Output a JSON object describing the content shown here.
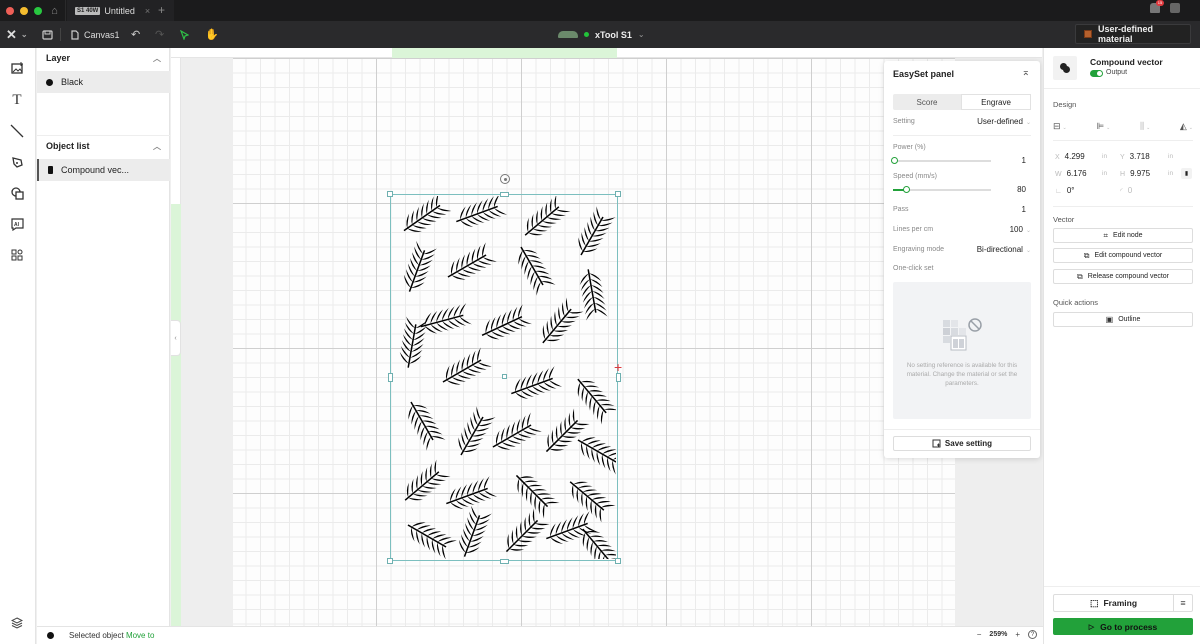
{
  "titlebar": {
    "traffic_colors": [
      "#ee5f57",
      "#f5bd2f",
      "#28c840"
    ],
    "home_icon": "home-icon",
    "tab": {
      "badge": "S1 40W",
      "title": "Untitled",
      "close": "×"
    },
    "new_tab": "+",
    "notification_count": "15"
  },
  "toolbar": {
    "logo": "✕",
    "logo_chevron": "⌄",
    "canvas_label": "Canvas1",
    "device_name": "xTool S1",
    "device_status_color": "#22c33a",
    "device_chevron": "⌄",
    "material_label": "User-defined material",
    "material_color": "#b5602d"
  },
  "left_tools": [
    {
      "name": "image-icon",
      "glyph": "🖼"
    },
    {
      "name": "text-icon",
      "glyph": "T"
    },
    {
      "name": "line-icon",
      "glyph": "╲"
    },
    {
      "name": "pen-icon",
      "glyph": "✎"
    },
    {
      "name": "shapes-icon",
      "glyph": "⧉"
    },
    {
      "name": "ai-icon",
      "glyph": "AI"
    },
    {
      "name": "apps-icon",
      "glyph": "⊞"
    }
  ],
  "layers_panel": {
    "layer_header": "Layer",
    "layers": [
      {
        "label": "Black",
        "color": "#111111"
      }
    ],
    "objects_header": "Object list",
    "objects": [
      {
        "label": "Compound vec..."
      }
    ]
  },
  "easyset": {
    "title": "EasySet panel",
    "tabs": [
      {
        "label": "Score",
        "active": false
      },
      {
        "label": "Engrave",
        "active": true
      }
    ],
    "setting_label": "Setting",
    "setting_value": "User-defined",
    "power_label": "Power (%)",
    "power_value": "1",
    "power_fraction": 0.01,
    "speed_label": "Speed (mm/s)",
    "speed_value": "80",
    "speed_fraction": 0.13,
    "pass_label": "Pass",
    "pass_value": "1",
    "lines_label": "Lines per cm",
    "lines_value": "100",
    "mode_label": "Engraving mode",
    "mode_value": "Bi-directional",
    "oneclick_label": "One-click set",
    "empty_text": "No setting reference is available for this material. Change the material or set the parameters.",
    "save_label": "Save setting"
  },
  "properties": {
    "object_title": "Compound vector",
    "output_label": "Output",
    "output_on": true,
    "design_header": "Design",
    "x_label": "X",
    "x_value": "4.299",
    "x_unit": "in",
    "y_label": "Y",
    "y_value": "3.718",
    "y_unit": "in",
    "w_label": "W",
    "w_value": "6.176",
    "w_unit": "in",
    "h_label": "H",
    "h_value": "9.975",
    "h_unit": "in",
    "rotation_value": "0°",
    "corner_value": "0",
    "vector_header": "Vector",
    "vector_buttons": [
      "Edit node",
      "Edit compound vector",
      "Release compound vector"
    ],
    "quick_header": "Quick actions",
    "quick_buttons": [
      "Outline"
    ],
    "framing_label": "Framing",
    "process_label": "Go to process",
    "accent": "#22a13a"
  },
  "statusbar": {
    "selected_text": "Selected object",
    "move_link": "Move to",
    "zoom_minus": "−",
    "zoom_value": "259%",
    "zoom_plus": "+",
    "help": "?"
  }
}
